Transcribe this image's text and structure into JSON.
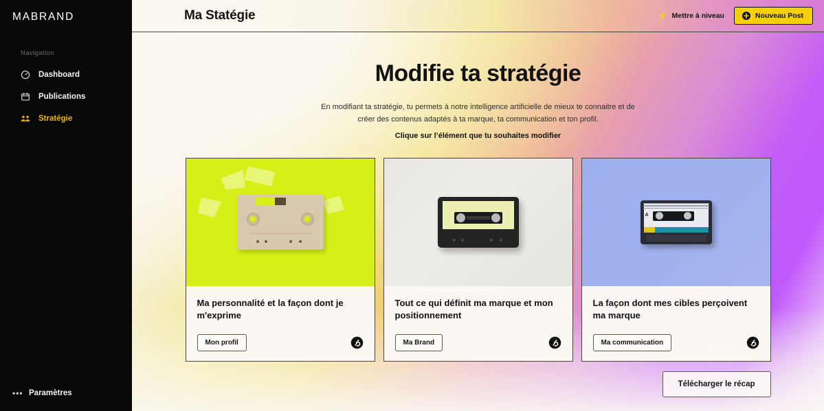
{
  "sidebar": {
    "brand": "MABRAND",
    "nav_label": "Navigation",
    "items": [
      {
        "label": "Dashboard",
        "icon": "dashboard-gauge-icon",
        "active": false
      },
      {
        "label": "Publications",
        "icon": "calendar-icon",
        "active": false
      },
      {
        "label": "Stratégie",
        "icon": "people-group-icon",
        "active": true
      }
    ],
    "footer": {
      "label": "Paramètres",
      "icon": "ellipsis-icon"
    }
  },
  "topbar": {
    "title": "Ma Statégie",
    "upgrade_label": "Mettre à niveau",
    "upgrade_icon": "lightning-bolt-icon",
    "new_post_label": "Nouveau Post",
    "new_post_icon": "plus-circle-icon"
  },
  "main": {
    "heading": "Modifie ta stratégie",
    "subtitle": "En modifiant ta stratégie, tu permets à notre intelligence artificielle de mieux te connaitre et de créer des contenus adaptés à ta marque, ta communication et ton profil.",
    "subtitle_strong": "Clique sur l’élément que tu souhaites modifier",
    "cards": [
      {
        "title": "Ma personnalité et la façon dont je m'exprime",
        "button": "Mon profil",
        "media": "cassette-beige-on-lime",
        "logo": "brand-circle-logo"
      },
      {
        "title": "Tout ce qui définit ma marque et mon positionnement",
        "button": "Ma Brand",
        "media": "cassette-black-on-grey",
        "logo": "brand-circle-logo"
      },
      {
        "title": "La façon dont mes cibles perçoivent ma marque",
        "button": "Ma communication",
        "media": "cassette-dark-on-periwinkle",
        "logo": "brand-circle-logo"
      }
    ],
    "download_label": "Télécharger le récap"
  },
  "colors": {
    "sidebar_bg": "#090909",
    "accent_yellow": "#f5cf0a",
    "active_nav": "#e8b400",
    "card_media_1": "#d6ef16",
    "card_media_2": "#e9e7e3",
    "card_media_3": "#9db0ee",
    "page_bg_cream": "#faf7f0",
    "page_bg_purple": "#c158fb",
    "border": "#4a453c"
  }
}
